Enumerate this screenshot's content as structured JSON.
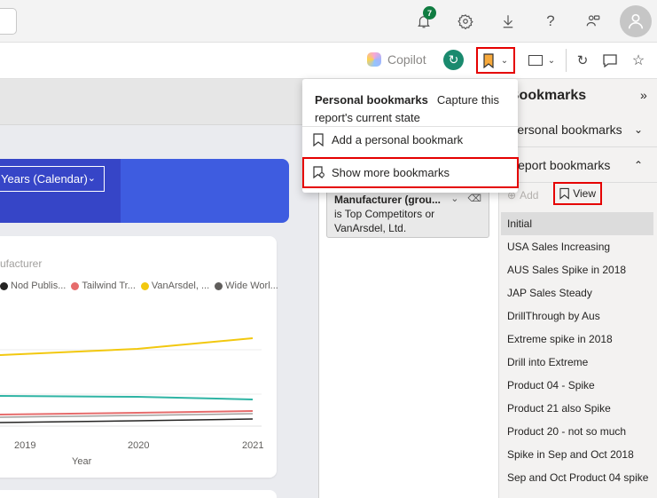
{
  "topbar": {
    "notification_count": "7",
    "icons": [
      "bell-icon",
      "gear-icon",
      "download-icon",
      "help-icon",
      "share-icon",
      "avatar-icon"
    ]
  },
  "toolbar": {
    "copilot_label": "Copilot",
    "icons": [
      "reset-icon",
      "bookmark-icon",
      "view-icon",
      "refresh-icon",
      "comment-icon",
      "favorite-icon"
    ]
  },
  "popup": {
    "title": "Personal bookmarks",
    "capture_text": "Capture this report's current state",
    "add_label": "Add a personal bookmark",
    "more_label": "Show more bookmarks"
  },
  "slicer": {
    "value": "Years (Calendar)"
  },
  "chart": {
    "subtitle": "ufacturer",
    "x_label": "Year"
  },
  "chart_data": {
    "type": "line",
    "title": "",
    "xlabel": "Year",
    "ylabel": "",
    "x": [
      "2019",
      "2020",
      "2021"
    ],
    "series": [
      {
        "name": "Nod Publis...",
        "color": "#252423",
        "values": [
          null,
          null,
          null
        ]
      },
      {
        "name": "Tailwind Tr...",
        "color": "#e66c6c",
        "values": [
          null,
          null,
          null
        ]
      },
      {
        "name": "VanArsdel, ...",
        "color": "#f2c80f",
        "values": [
          null,
          null,
          null
        ]
      },
      {
        "name": "Wide Worl...",
        "color": "#605e5c",
        "values": [
          null,
          null,
          null
        ]
      }
    ],
    "grid": true,
    "legend": "top"
  },
  "filter": {
    "title": "Manufacturer (grou...",
    "value": "is Top Competitors or VanArsdel, Ltd."
  },
  "bookmarks_pane": {
    "title": "Bookmarks",
    "personal_label": "Personal bookmarks",
    "report_label": "Report bookmarks",
    "add_label": "Add",
    "view_label": "View",
    "items": [
      "Initial",
      "USA Sales Increasing",
      "AUS Sales Spike in 2018",
      "JAP Sales Steady",
      "DrillThrough by Aus",
      "Extreme spike in 2018",
      "Drill into Extreme",
      "Product 04 - Spike",
      "Product 21 also Spike",
      "Product 20 - not so much",
      "Spike in Sep and Oct 2018",
      "Sep and Oct Product 04 spike"
    ]
  }
}
